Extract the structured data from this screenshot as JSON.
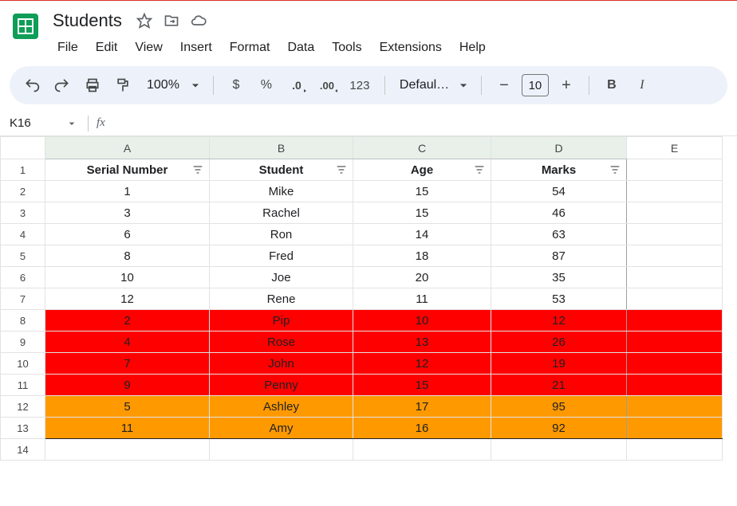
{
  "doc": {
    "title": "Students"
  },
  "menus": [
    "File",
    "Edit",
    "View",
    "Insert",
    "Format",
    "Data",
    "Tools",
    "Extensions",
    "Help"
  ],
  "toolbar": {
    "zoom": "100%",
    "currency": "$",
    "percent": "%",
    "dec_dec": ".0",
    "inc_dec": ".00",
    "num": "123",
    "font": "Defaul…",
    "font_size": "10",
    "bold": "B",
    "italic": "I"
  },
  "namebox": {
    "cell": "K16",
    "fx": "fx"
  },
  "columns": [
    "A",
    "B",
    "C",
    "D",
    "E"
  ],
  "headers": [
    "Serial Number",
    "Student",
    "Age",
    "Marks"
  ],
  "rows": [
    {
      "n": 1,
      "bg": "",
      "cells": [
        "1",
        "Mike",
        "15",
        "54"
      ]
    },
    {
      "n": 2,
      "bg": "",
      "cells": [
        "3",
        "Rachel",
        "15",
        "46"
      ]
    },
    {
      "n": 3,
      "bg": "",
      "cells": [
        "6",
        "Ron",
        "14",
        "63"
      ]
    },
    {
      "n": 4,
      "bg": "",
      "cells": [
        "8",
        "Fred",
        "18",
        "87"
      ]
    },
    {
      "n": 5,
      "bg": "",
      "cells": [
        "10",
        "Joe",
        "20",
        "35"
      ]
    },
    {
      "n": 6,
      "bg": "",
      "cells": [
        "12",
        "Rene",
        "11",
        "53"
      ]
    },
    {
      "n": 7,
      "bg": "red",
      "cells": [
        "2",
        "Pip",
        "10",
        "12"
      ]
    },
    {
      "n": 8,
      "bg": "red",
      "cells": [
        "4",
        "Rose",
        "13",
        "26"
      ]
    },
    {
      "n": 9,
      "bg": "red",
      "cells": [
        "7",
        "John",
        "12",
        "19"
      ]
    },
    {
      "n": 10,
      "bg": "red",
      "cells": [
        "9",
        "Penny",
        "15",
        "21"
      ]
    },
    {
      "n": 11,
      "bg": "orange",
      "cells": [
        "5",
        "Ashley",
        "17",
        "95"
      ]
    },
    {
      "n": 12,
      "bg": "orange",
      "cells": [
        "11",
        "Amy",
        "16",
        "92"
      ]
    }
  ]
}
